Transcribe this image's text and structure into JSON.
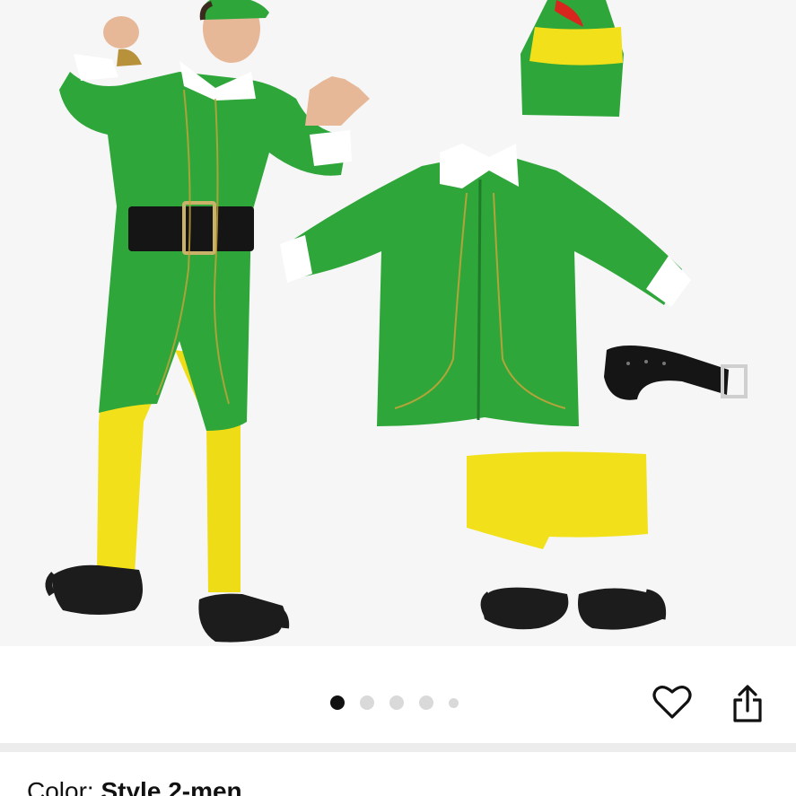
{
  "gallery": {
    "images": [
      "elf-costume-model",
      "elf-hat",
      "elf-coat",
      "elf-belt",
      "elf-leggings",
      "elf-shoes"
    ],
    "page_dots": 5,
    "active_index": 0
  },
  "actions": {
    "favorite_icon": "heart-icon",
    "share_icon": "share-icon"
  },
  "product": {
    "color_label": "Color:",
    "color_value": "Style 2-men"
  },
  "colors": {
    "costume_green": "#2ea63a",
    "legging_yellow": "#f2e01a",
    "dot_active": "#111111",
    "dot_inactive": "#d9d9d9"
  }
}
